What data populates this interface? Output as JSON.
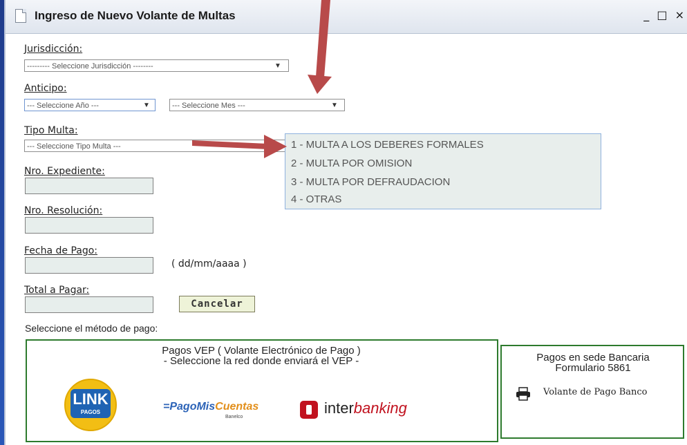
{
  "window": {
    "title": "Ingreso de Nuevo Volante de Multas",
    "controls": [
      "_",
      "□",
      "×"
    ]
  },
  "form": {
    "jurisdiccion": {
      "label": "Jurisdicción:",
      "selected": "--------- Seleccione Jurisdicción --------"
    },
    "anticipo": {
      "label": "Anticipo:",
      "anio_selected": "--- Seleccione Año ---",
      "mes_selected": "--- Seleccione Mes ---"
    },
    "tipo_multa": {
      "label": "Tipo Multa:",
      "selected": "--- Seleccione Tipo Multa ---",
      "options": [
        "1 - MULTA A LOS DEBERES FORMALES",
        "2 - MULTA POR OMISION",
        "3 - MULTA POR DEFRAUDACION",
        "4 - OTRAS"
      ]
    },
    "nro_expediente": {
      "label": "Nro. Expediente:",
      "value": ""
    },
    "nro_resolucion": {
      "label": "Nro. Resolución:",
      "value": ""
    },
    "fecha_pago": {
      "label": "Fecha de Pago:",
      "value": "",
      "hint": "( dd/mm/aaaa )"
    },
    "total_pagar": {
      "label": "Total a Pagar:",
      "value": ""
    },
    "cancel_label": "Cancelar"
  },
  "payment": {
    "method_label": "Seleccione el método de pago:",
    "vep": {
      "title_line1": "Pagos VEP ( Volante Electrónico de Pago )",
      "title_line2": "- Seleccione la red donde enviará el VEP -",
      "networks": {
        "link": {
          "name": "LINK",
          "sub": "PAGOS"
        },
        "pagomiscuentas": {
          "part1": "PagoMis",
          "part2": "Cuentas",
          "sub": "Banelco"
        },
        "interbanking": {
          "part1": "inter",
          "part2": "banking"
        }
      }
    },
    "bank": {
      "title_line1": "Pagos en sede Bancaria",
      "title_line2": "Formulario 5861",
      "volante_label": "Volante de Pago Banco"
    }
  },
  "colors": {
    "arrow": "#b84a4a",
    "box_border": "#2d7a2d",
    "dropdown_bg": "#e8eeec"
  }
}
